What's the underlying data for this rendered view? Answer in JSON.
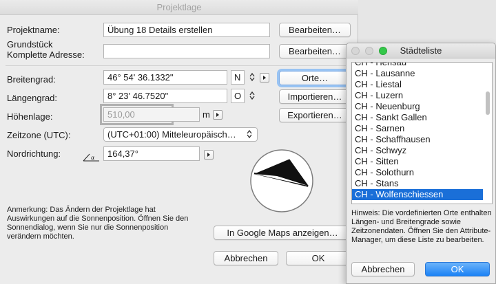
{
  "main": {
    "title": "Projektlage",
    "project_name": {
      "label": "Projektname:",
      "value": "Übung 18 Details erstellen",
      "button": "Bearbeiten…"
    },
    "address": {
      "label_line1": "Grundstück",
      "label_line2": "Komplette Adresse:",
      "value": "",
      "button": "Bearbeiten…"
    },
    "latitude": {
      "label": "Breitengrad:",
      "value": "46° 54' 36.1332\"",
      "hemisphere": "N",
      "button": "Orte…"
    },
    "longitude": {
      "label": "Längengrad:",
      "value": "8° 23' 46.7520\"",
      "hemisphere": "O",
      "button": "Importieren…"
    },
    "elevation": {
      "label": "Höhenlage:",
      "value": "510,00",
      "unit": "m",
      "button": "Exportieren…"
    },
    "timezone": {
      "label": "Zeitzone (UTC):",
      "value": "(UTC+01:00) Mitteleuropäisch…"
    },
    "north": {
      "label": "Nordrichtung:",
      "value": "164,37°"
    },
    "note": "Anmerkung: Das Ändern der Projektlage hat Auswirkungen auf die Sonnenposition. Öffnen Sie den Sonnendialog, wenn Sie nur die Sonnenposition verändern möchten.",
    "google_maps_button": "In Google Maps anzeigen…",
    "cancel_button": "Abbrechen",
    "ok_button": "OK"
  },
  "city_window": {
    "title": "Städteliste",
    "items": [
      "CH - Herisau",
      "CH - Lausanne",
      "CH - Liestal",
      "CH - Luzern",
      "CH - Neuenburg",
      "CH - Sankt Gallen",
      "CH - Sarnen",
      "CH - Schaffhausen",
      "CH - Schwyz",
      "CH - Sitten",
      "CH - Solothurn",
      "CH - Stans",
      "CH - Wolfenschiessen"
    ],
    "selected": "CH - Wolfenschiessen",
    "hint": "Hinweis: Die vordefinierten Orte enthalten Längen- und Breitengrade sowie Zeitzonendaten. Öffnen Sie den Attribute-Manager, um diese Liste zu bearbeiten.",
    "cancel_button": "Abbrechen",
    "ok_button": "OK"
  },
  "colors": {
    "accent": "#1a6fd8",
    "ok_button": "#1b82f5",
    "traffic_green": "#34c84a"
  }
}
